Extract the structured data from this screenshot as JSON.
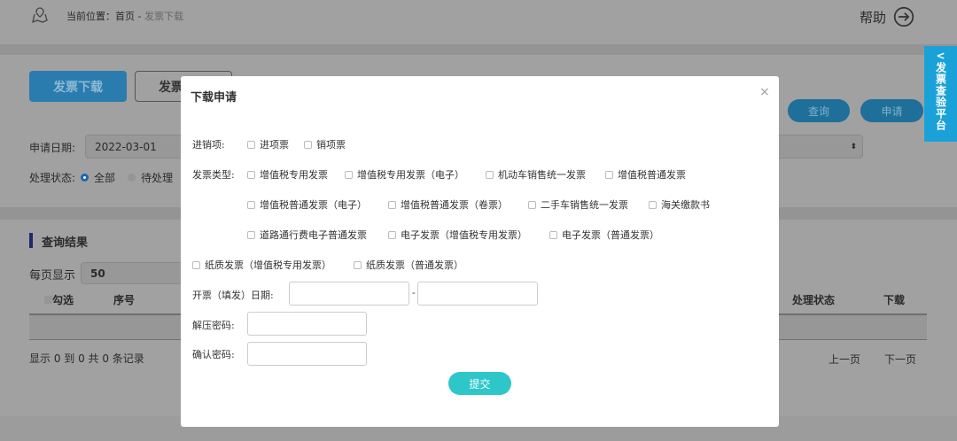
{
  "header": {
    "location_label": "当前位置：",
    "home": "首页",
    "separator": " - ",
    "current": "发票下载",
    "help": "帮助"
  },
  "tabs": {
    "active": "发票下载",
    "second": "发票"
  },
  "filters": {
    "apply_date_label": "申请日期:",
    "apply_date_value": "2022-03-01",
    "status_label": "处理状态:",
    "status_options": [
      "全部",
      "待处理"
    ],
    "query": "查询",
    "apply": "申请"
  },
  "side_panel": {
    "label": "发票查验平台"
  },
  "results": {
    "title": "查询结果",
    "page_size_label": "每页显示",
    "page_size_value": "50",
    "columns": {
      "select": "勾选",
      "index": "序号",
      "status": "处理状态",
      "download": "下载"
    },
    "summary": "显示 0 到 0 共 0 条记录",
    "prev": "上一页",
    "next": "下一页"
  },
  "modal": {
    "title": "下载申请",
    "direction_label": "进销项:",
    "direction_options": [
      "进项票",
      "销项票"
    ],
    "type_label": "发票类型:",
    "type_rows": [
      [
        "增值税专用发票",
        "增值税专用发票（电子）",
        "机动车销售统一发票",
        "增值税普通发票"
      ],
      [
        "增值税普通发票（电子）",
        "增值税普通发票（卷票）",
        "二手车销售统一发票",
        "海关缴款书"
      ],
      [
        "道路通行费电子普通发票",
        "电子发票（增值税专用发票）",
        "电子发票（普通发票）"
      ],
      [
        "纸质发票（增值税专用发票）",
        "纸质发票（普通发票）"
      ]
    ],
    "date_label": "开票（填发）日期:",
    "date_sep": "-",
    "unzip_label": "解压密码:",
    "confirm_label": "确认密码:",
    "submit": "提交"
  },
  "colors": {
    "primary": "#2a7cae",
    "submit": "#2ec7c9",
    "side": "#1aa2d8"
  }
}
